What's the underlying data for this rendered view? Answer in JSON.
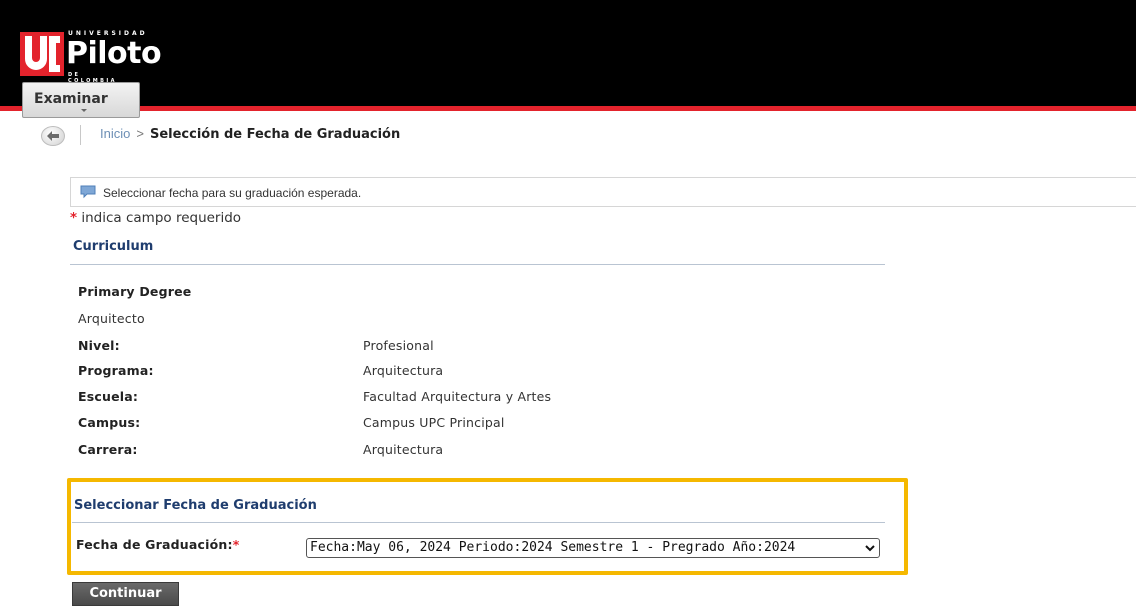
{
  "header": {
    "logo": {
      "mark": "UP",
      "top_text": "UNIVERSIDAD",
      "name": "Piloto",
      "bottom_text": "DE COLOMBIA"
    },
    "menu_button": "Examinar",
    "accent_color": "#e3232c"
  },
  "breadcrumb": {
    "back_icon": "back-arrow-icon",
    "home": "Inicio",
    "separator": ">",
    "current": "Selección de Fecha de Graduación"
  },
  "info_message": {
    "icon": "message-icon",
    "text": "Seleccionar fecha para su graduación esperada."
  },
  "required_note": {
    "star": "*",
    "text": "indica campo requerido"
  },
  "curriculum": {
    "title": "Curriculum",
    "degree_heading": "Primary Degree",
    "degree": "Arquitecto",
    "rows": [
      {
        "label": "Nivel:",
        "value": "Profesional"
      },
      {
        "label": "Programa:",
        "value": "Arquitectura"
      },
      {
        "label": "Escuela:",
        "value": "Facultad Arquitectura y Artes"
      },
      {
        "label": "Campus:",
        "value": "Campus UPC Principal"
      },
      {
        "label": "Carrera:",
        "value": "Arquitectura"
      }
    ]
  },
  "graduation": {
    "title": "Seleccionar Fecha de Graduación",
    "field_label": "Fecha de Graduación:",
    "required_star": "*",
    "selected_option": "Fecha:May 06, 2024 Periodo:2024 Semestre 1 - Pregrado Año:2024",
    "highlight_color": "#f5b800"
  },
  "actions": {
    "continue": "Continuar"
  }
}
